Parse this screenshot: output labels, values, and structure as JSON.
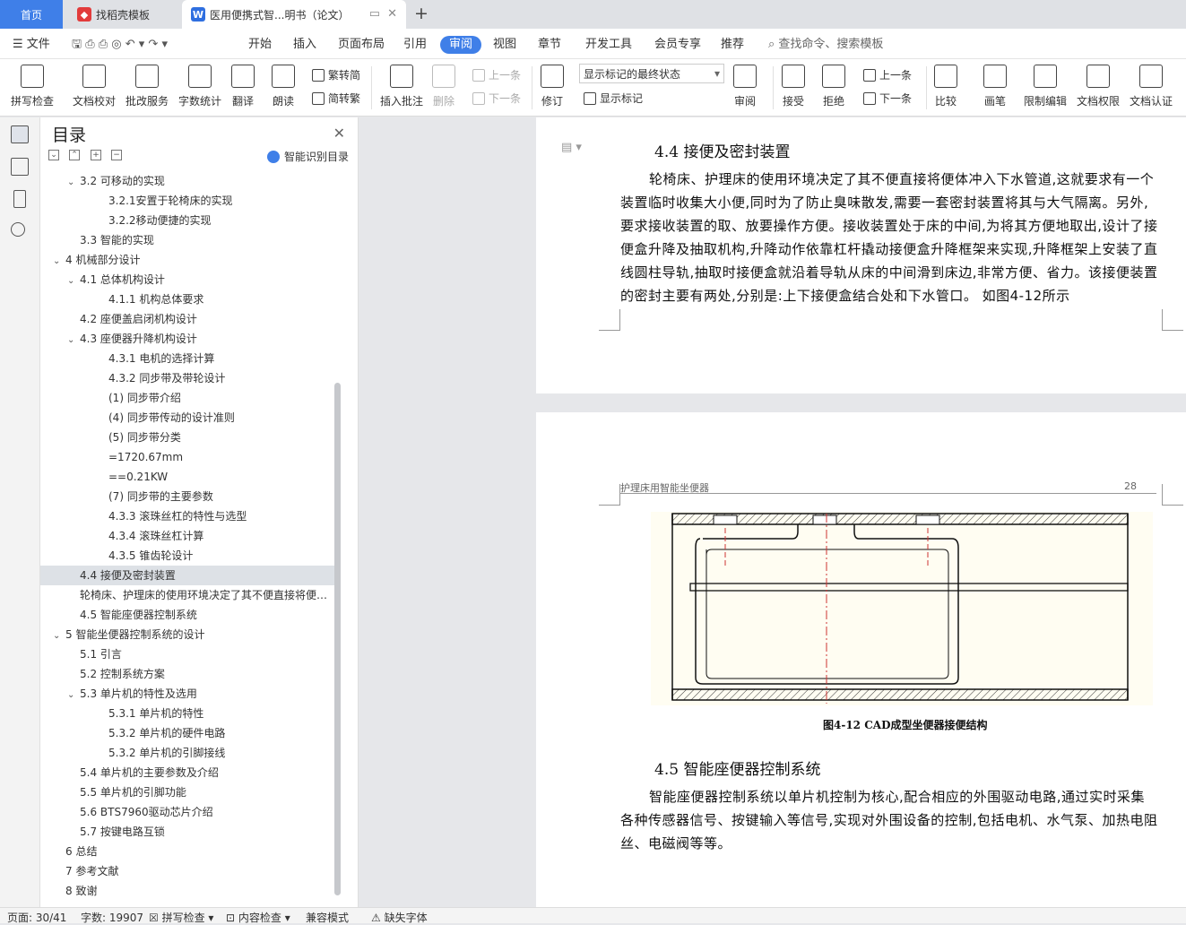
{
  "tabs": {
    "home": "首页",
    "template": "找稻壳模板",
    "doc": "医用便携式智...明书（论文）"
  },
  "menu": {
    "file": "文件",
    "items": [
      "开始",
      "插入",
      "页面布局",
      "引用",
      "审阅",
      "视图",
      "章节",
      "开发工具",
      "会员专享",
      "推荐"
    ],
    "active": "审阅",
    "search": "查找命令、搜索模板"
  },
  "ribbon": {
    "spell": "拼写检查",
    "proof": "文档校对",
    "batch": "批改服务",
    "wordcount": "字数统计",
    "translate": "翻译",
    "read": "朗读",
    "trad": "繁转简",
    "simp": "简转繁",
    "insert_comment": "插入批注",
    "delete": "删除",
    "prev": "上一条",
    "next": "下一条",
    "track": "修订",
    "markup_state": "显示标记的最终状态",
    "show_markup": "显示标记",
    "review": "审阅",
    "accept": "接受",
    "reject": "拒绝",
    "prev2": "上一条",
    "next2": "下一条",
    "compare": "比较",
    "pen": "画笔",
    "restrict": "限制编辑",
    "rights": "文档权限",
    "certify": "文档认证"
  },
  "nav": {
    "title": "目录",
    "smart": "智能识别目录",
    "items": [
      {
        "text": "3.2 可移动的实现",
        "level": 1,
        "caret": "v"
      },
      {
        "text": "3.2.1安置于轮椅床的实现",
        "level": 2,
        "caret": ""
      },
      {
        "text": "3.2.2移动便捷的实现",
        "level": 2,
        "caret": ""
      },
      {
        "text": "3.3 智能的实现",
        "level": 1,
        "caret": ""
      },
      {
        "text": "4 机械部分设计",
        "level": 0,
        "caret": "v"
      },
      {
        "text": "4.1 总体机构设计",
        "level": 1,
        "caret": "v"
      },
      {
        "text": "4.1.1 机构总体要求",
        "level": 2,
        "caret": ""
      },
      {
        "text": "4.2 座便盖启闭机构设计",
        "level": 1,
        "caret": ""
      },
      {
        "text": "4.3 座便器升降机构设计",
        "level": 1,
        "caret": "v"
      },
      {
        "text": "4.3.1 电机的选择计算",
        "level": 2,
        "caret": ""
      },
      {
        "text": "4.3.2 同步带及带轮设计",
        "level": 2,
        "caret": ""
      },
      {
        "text": "(1)  同步带介绍",
        "level": 2,
        "caret": ""
      },
      {
        "text": "(4)   同步带传动的设计准则",
        "level": 2,
        "caret": ""
      },
      {
        "text": "(5)   同步带分类",
        "level": 2,
        "caret": ""
      },
      {
        "text": "=1720.67mm",
        "level": 2,
        "caret": ""
      },
      {
        "text": "==0.21KW",
        "level": 2,
        "caret": ""
      },
      {
        "text": "(7)  同步带的主要参数",
        "level": 2,
        "caret": ""
      },
      {
        "text": "4.3.3 滚珠丝杠的特性与选型",
        "level": 2,
        "caret": ""
      },
      {
        "text": "4.3.4 滚珠丝杠计算",
        "level": 2,
        "caret": ""
      },
      {
        "text": "4.3.5 锥齿轮设计",
        "level": 2,
        "caret": ""
      },
      {
        "text": "4.4 接便及密封装置",
        "level": 1,
        "caret": "",
        "selected": true
      },
      {
        "text": "轮椅床、护理床的使用环境决定了其不便直接将便…",
        "level": 1,
        "caret": ""
      },
      {
        "text": "4.5 智能座便器控制系统",
        "level": 1,
        "caret": ""
      },
      {
        "text": "5 智能坐便器控制系统的设计",
        "level": 0,
        "caret": "v"
      },
      {
        "text": "5.1 引言",
        "level": 1,
        "caret": ""
      },
      {
        "text": "5.2 控制系统方案",
        "level": 1,
        "caret": ""
      },
      {
        "text": "5.3 单片机的特性及选用",
        "level": 1,
        "caret": "v"
      },
      {
        "text": "5.3.1 单片机的特性",
        "level": 2,
        "caret": ""
      },
      {
        "text": "5.3.2 单片机的硬件电路",
        "level": 2,
        "caret": ""
      },
      {
        "text": "5.3.2 单片机的引脚接线",
        "level": 2,
        "caret": ""
      },
      {
        "text": "5.4 单片机的主要参数及介绍",
        "level": 1,
        "caret": ""
      },
      {
        "text": "5.5 单片机的引脚功能",
        "level": 1,
        "caret": ""
      },
      {
        "text": "5.6 BTS7960驱动芯片介绍",
        "level": 1,
        "caret": ""
      },
      {
        "text": "5.7 按键电路互锁",
        "level": 1,
        "caret": ""
      },
      {
        "text": "6 总结",
        "level": 0,
        "caret": ""
      },
      {
        "text": "7 参考文献",
        "level": 0,
        "caret": ""
      },
      {
        "text": "8 致谢",
        "level": 0,
        "caret": ""
      }
    ]
  },
  "doc": {
    "h44": "4.4 接便及密封装置",
    "p44": "轮椅床、护理床的使用环境决定了其不便直接将便体冲入下水管道,这就要求有一个装置临时收集大小便,同时为了防止臭味散发,需要一套密封装置将其与大气隔离。另外,要求接收装置的取、放要操作方便。接收装置处于床的中间,为将其方便地取出,设计了接便盒升降及抽取机构,升降动作依靠杠杆撬动接便盒升降框架来实现,升降框架上安装了直线圆柱导轨,抽取时接便盒就沿着导轨从床的中间滑到床边,非常方便、省力。该接便装置的密封主要有两处,分别是:上下接便盒结合处和下水管口。 如图4-12所示",
    "header_left": "护理床用智能坐便器",
    "header_right": "28",
    "caption": "图4-12 CAD成型坐便器接便结构",
    "h45": "4.5 智能座便器控制系统",
    "p45": "智能座便器控制系统以单片机控制为核心,配合相应的外围驱动电路,通过实时采集各种传感器信号、按键输入等信号,实现对外围设备的控制,包括电机、水气泵、加热电阻丝、电磁阀等等。"
  },
  "status": {
    "page": "页面: 30/41",
    "words": "字数: 19907",
    "spell": "拼写检查",
    "content": "内容检查",
    "compat": "兼容模式",
    "missing_font": "缺失字体"
  }
}
